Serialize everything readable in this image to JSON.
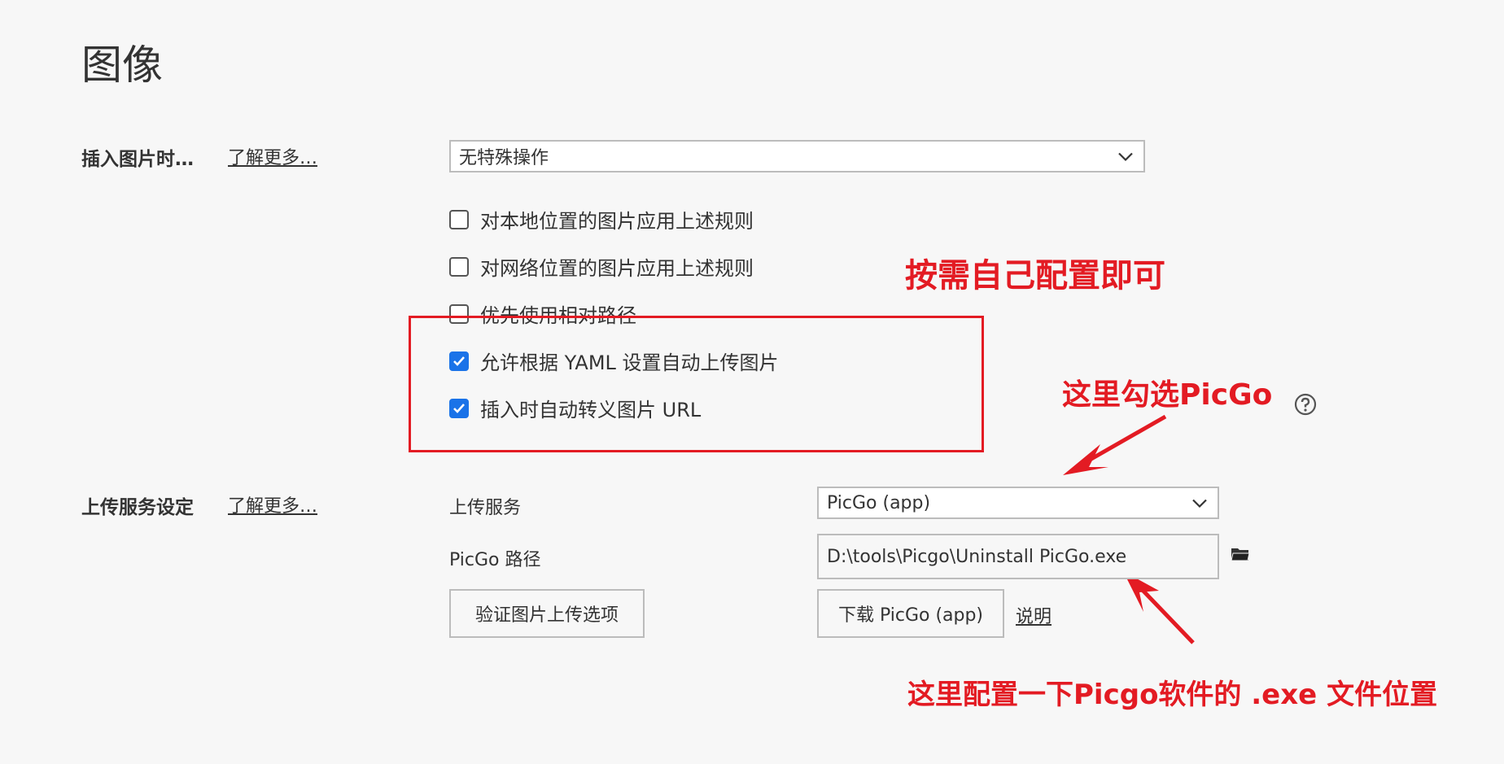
{
  "page": {
    "title": "图像"
  },
  "insert_section": {
    "label": "插入图片时…",
    "learn_more": "了解更多…",
    "select_value": "无特殊操作",
    "options": [
      {
        "label": "对本地位置的图片应用上述规则",
        "checked": false
      },
      {
        "label": "对网络位置的图片应用上述规则",
        "checked": false
      },
      {
        "label": "优先使用相对路径",
        "checked": false
      },
      {
        "label": "允许根据 YAML 设置自动上传图片",
        "checked": true
      },
      {
        "label": "插入时自动转义图片 URL",
        "checked": true
      }
    ]
  },
  "upload_section": {
    "label": "上传服务设定",
    "learn_more": "了解更多…",
    "service_label": "上传服务",
    "service_value": "PicGo (app)",
    "path_label": "PicGo 路径",
    "path_value": "D:\\tools\\Picgo\\Uninstall PicGo.exe",
    "verify_button": "验证图片上传选项",
    "download_button": "下载 PicGo (app)",
    "explain_link": "说明"
  },
  "annotations": {
    "config_note": "按需自己配置即可",
    "picgo_note": "这里勾选PicGo",
    "exe_note": "这里配置一下Picgo软件的 .exe 文件位置"
  },
  "icons": {
    "help": "question-circle-icon",
    "folder": "folder-icon",
    "chevron": "chevron-down-icon"
  },
  "colors": {
    "annotation_red": "#e31b23",
    "checkbox_blue": "#1a73e8"
  }
}
